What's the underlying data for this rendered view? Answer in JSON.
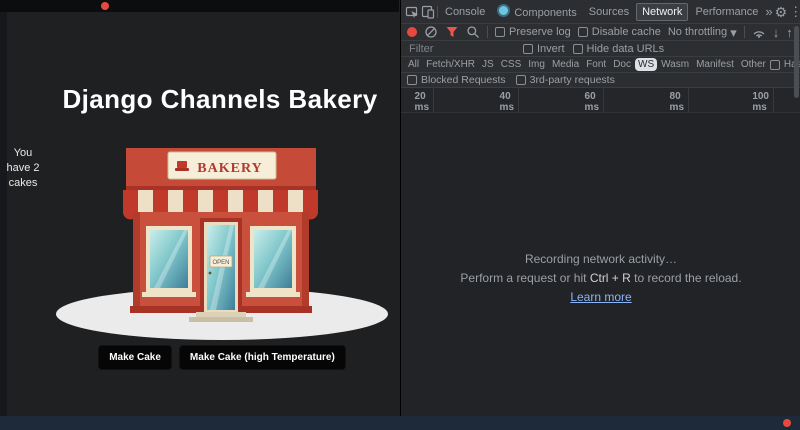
{
  "page": {
    "title": "Django Channels Bakery",
    "cake_counter": "You have 2 cakes",
    "sign_text": "BAKERY",
    "open_sign": "OPEN",
    "buttons": [
      {
        "label": "Make Cake"
      },
      {
        "label": "Make Cake (high Temperature)"
      }
    ]
  },
  "devtools": {
    "tabs": [
      {
        "label": "Console",
        "active": false
      },
      {
        "label": "Components",
        "active": false
      },
      {
        "label": "Sources",
        "active": false
      },
      {
        "label": "Network",
        "active": true
      },
      {
        "label": "Performance",
        "active": false
      }
    ],
    "more_tabs_glyph": "»",
    "icons": {
      "gear": "⚙",
      "kebab": "⋮",
      "close": "✕",
      "caret": "▾",
      "import_arrow": "↓",
      "export_arrow": "↑"
    },
    "toolbar": {
      "preserve_log": "Preserve log",
      "disable_cache": "Disable cache",
      "throttling": "No throttling"
    },
    "filter_row": {
      "placeholder": "Filter",
      "invert": "Invert",
      "hide_data_urls": "Hide data URLs"
    },
    "chips": [
      {
        "label": "All",
        "selected": false
      },
      {
        "label": "Fetch/XHR",
        "selected": false
      },
      {
        "label": "JS",
        "selected": false
      },
      {
        "label": "CSS",
        "selected": false
      },
      {
        "label": "Img",
        "selected": false
      },
      {
        "label": "Media",
        "selected": false
      },
      {
        "label": "Font",
        "selected": false
      },
      {
        "label": "Doc",
        "selected": false
      },
      {
        "label": "WS",
        "selected": true
      },
      {
        "label": "Wasm",
        "selected": false
      },
      {
        "label": "Manifest",
        "selected": false
      },
      {
        "label": "Other",
        "selected": false
      }
    ],
    "has_blocked_cookies": "Has blocked cookies",
    "blocked_requests": "Blocked Requests",
    "third_party_requests": "3rd-party requests",
    "ruler_ticks": [
      "20 ms",
      "40 ms",
      "60 ms",
      "80 ms",
      "100 ms"
    ],
    "empty_state": {
      "line1": "Recording network activity…",
      "line2_prefix": "Perform a request or hit ",
      "line2_key": "Ctrl + R",
      "line2_suffix": " to record the reload.",
      "link": "Learn more"
    }
  },
  "recording": {
    "indicator_color": "#e8493f"
  }
}
